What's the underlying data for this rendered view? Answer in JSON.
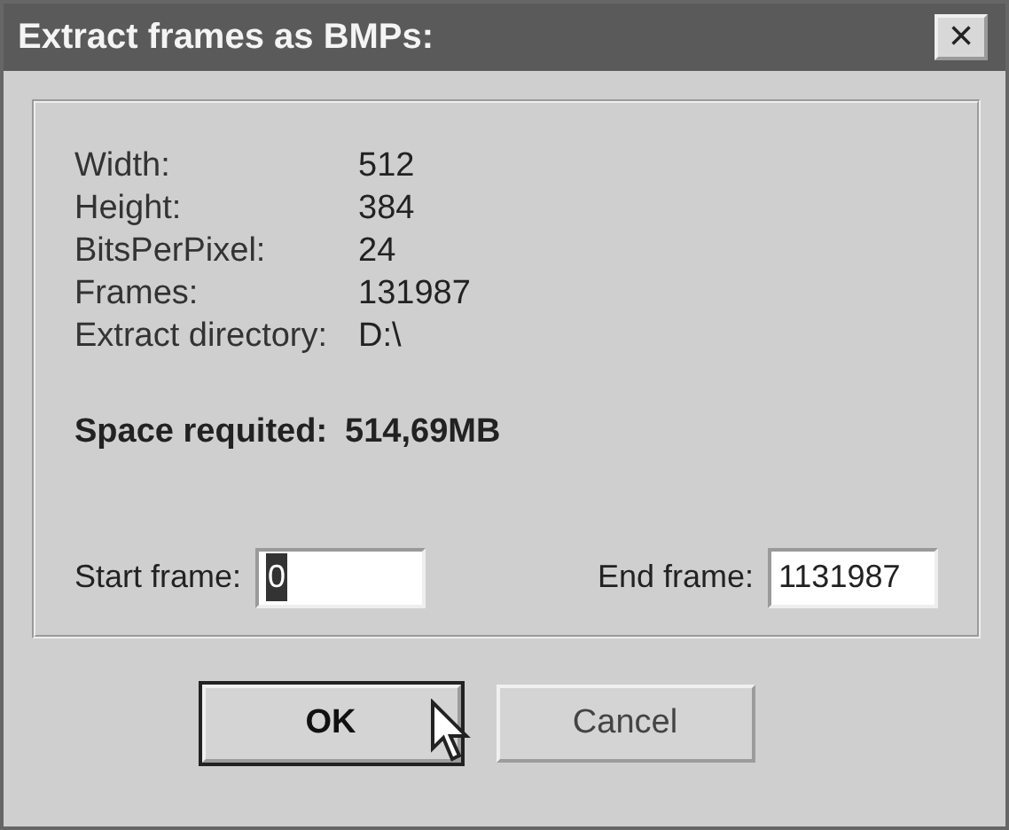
{
  "window": {
    "title": "Extract frames as BMPs:",
    "close": "×"
  },
  "info": [
    {
      "label": "Width:",
      "value": "512"
    },
    {
      "label": "Height:",
      "value": "384"
    },
    {
      "label": "BitsPerPixel:",
      "value": "24"
    },
    {
      "label": "Frames:",
      "value": "131987"
    },
    {
      "label": "Extract directory:",
      "value": "D:\\"
    }
  ],
  "space": {
    "label": "Space requited:",
    "value": "514,69MB"
  },
  "fields": [
    {
      "label": "Start frame:",
      "value": "0",
      "text_selected": true
    },
    {
      "label": "End frame:",
      "value": "1131987",
      "text_selected": false
    }
  ],
  "buttons": [
    {
      "label": "OK",
      "default": true
    },
    {
      "label": "Cancel",
      "default": false
    }
  ]
}
